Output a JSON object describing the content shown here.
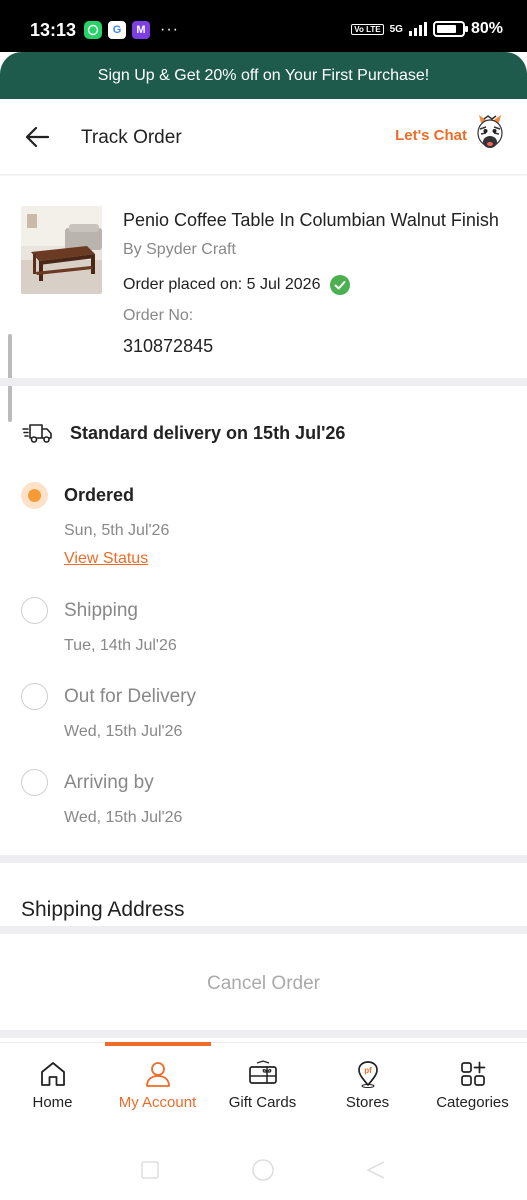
{
  "status_bar": {
    "time": "13:13",
    "apps": [
      "whatsapp-icon",
      "google-icon",
      "m-app-icon"
    ],
    "overflow": "···",
    "volte": "Vo LTE",
    "network": "5G",
    "battery": "80%",
    "battery_level": 0.8
  },
  "promo": {
    "text": "Sign Up & Get 20% off on Your First Purchase!"
  },
  "header": {
    "title": "Track Order",
    "chat_label": "Let's Chat"
  },
  "product": {
    "title": "Penio Coffee Table In Columbian Walnut Finish",
    "brand": "By Spyder Craft",
    "placed_label": "Order placed on: 5 Jul 2026",
    "order_no_label": "Order No:",
    "order_no": "310872845"
  },
  "delivery": {
    "title": "Standard delivery on 15th Jul'26",
    "view_status": "View Status",
    "steps": [
      {
        "name": "Ordered",
        "date": "Sun, 5th Jul'26",
        "active": true
      },
      {
        "name": "Shipping",
        "date": "Tue, 14th Jul'26",
        "active": false
      },
      {
        "name": "Out for Delivery",
        "date": "Wed, 15th Jul'26",
        "active": false
      },
      {
        "name": "Arriving by",
        "date": "Wed, 15th Jul'26",
        "active": false
      }
    ]
  },
  "shipping_address": {
    "title": "Shipping Address"
  },
  "cancel": {
    "label": "Cancel Order"
  },
  "bottom_nav": {
    "items": [
      {
        "label": "Home",
        "icon": "home-icon"
      },
      {
        "label": "My Account",
        "icon": "account-icon",
        "active": true
      },
      {
        "label": "Gift Cards",
        "icon": "gift-card-icon"
      },
      {
        "label": "Stores",
        "icon": "store-pin-icon"
      },
      {
        "label": "Categories",
        "icon": "categories-icon"
      }
    ]
  },
  "colors": {
    "accent": "#ef6c28",
    "promo_bg": "#1e5b4d",
    "active_step": "#f59a35",
    "success": "#4caf50"
  }
}
